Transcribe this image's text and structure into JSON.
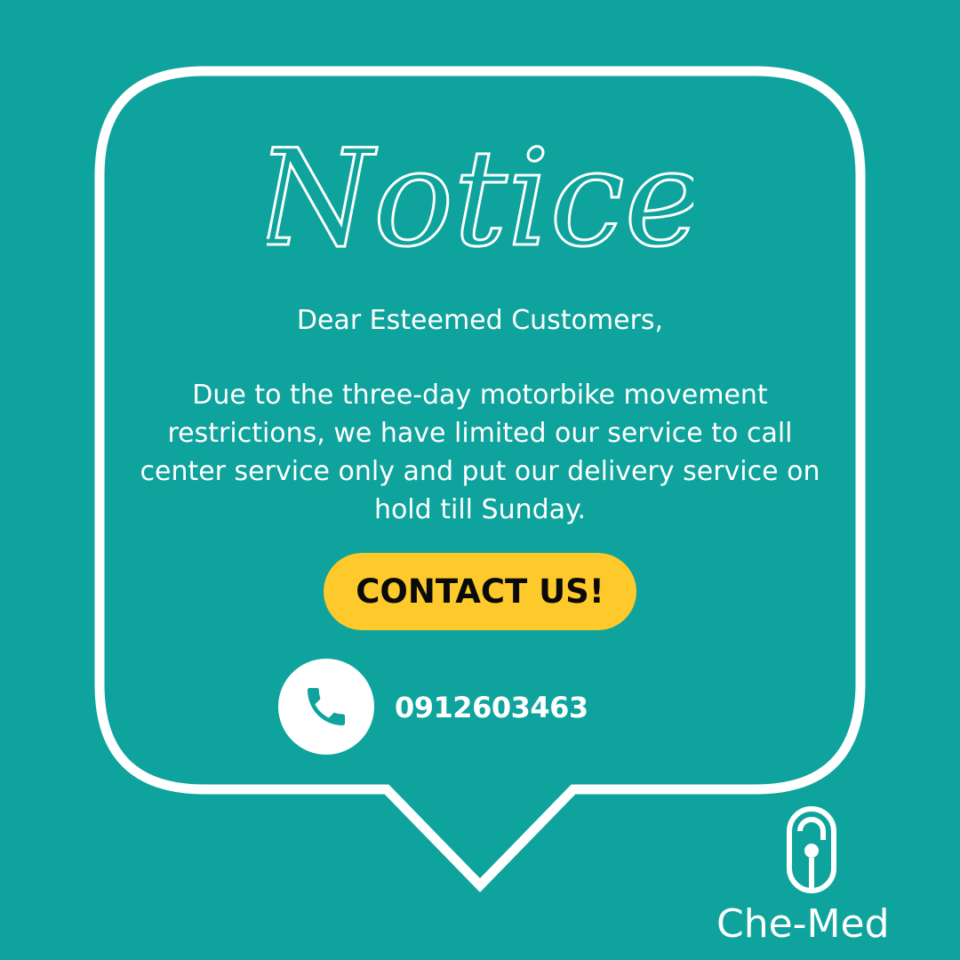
{
  "colors": {
    "background": "#0ea39c",
    "bubble_outline": "#ffffff",
    "button": "#fec92a",
    "button_text": "#0a0a0a",
    "text": "#ffffff"
  },
  "notice": {
    "title": "Notice",
    "greeting": "Dear Esteemed Customers,",
    "body_lines": [
      "Due to the three-day motorbike movement",
      "restrictions, we have limited our service to call",
      "center service only and put our delivery service on",
      "hold till Sunday."
    ]
  },
  "contact": {
    "button_label": "CONTACT US!",
    "phone_icon": "phone-icon",
    "phone_number": "0912603463"
  },
  "brand": {
    "logo_icon": "che-med-logo-icon",
    "name": "Che-Med"
  }
}
